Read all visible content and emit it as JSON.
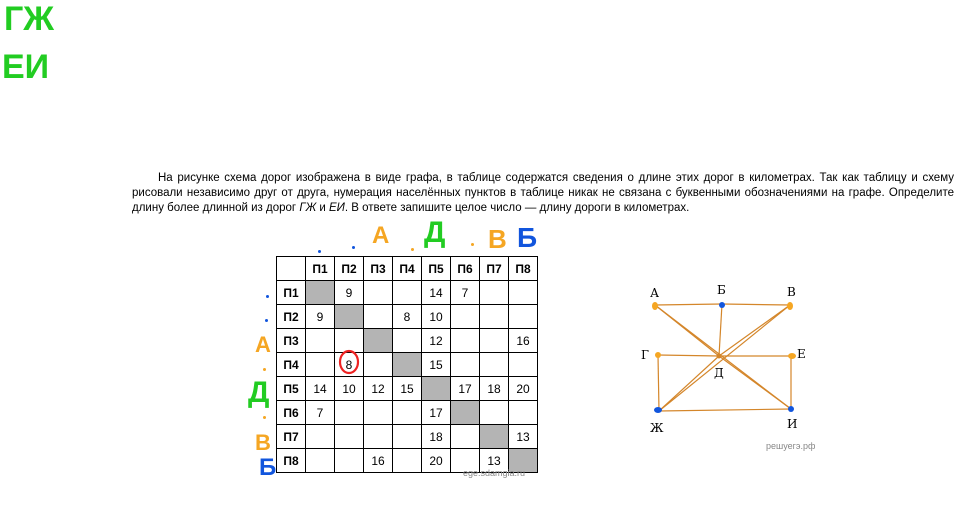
{
  "annotations": {
    "top_left_line1": "ГЖ",
    "top_left_line2": "ЕИ",
    "col_marks": [
      "А",
      "Д",
      "В",
      "Б"
    ],
    "row_marks": [
      "А",
      "Д",
      "В",
      "Б"
    ],
    "circled_value": "8"
  },
  "task": {
    "text_part1": "На рисунке схема дорог изображена в виде графа, в таблице содержатся сведения о длине этих дорог в километрах. Так как таблицу и схему рисовали независимо друг от друга, нумерация населённых пунктов в таблице никак не связана с буквенными обозначениями на графе. Определите длину более длинной из дорог ",
    "road1": "ГЖ",
    "conj": " и ",
    "road2": "ЕИ",
    "text_part2": ". В ответе запишите целое число — длину дороги в километрах."
  },
  "table": {
    "headers": [
      "П1",
      "П2",
      "П3",
      "П4",
      "П5",
      "П6",
      "П7",
      "П8"
    ],
    "rows": [
      {
        "label": "П1",
        "cells": [
          "",
          "9",
          "",
          "",
          "14",
          "7",
          "",
          ""
        ]
      },
      {
        "label": "П2",
        "cells": [
          "9",
          "",
          "",
          "8",
          "10",
          "",
          "",
          ""
        ]
      },
      {
        "label": "П3",
        "cells": [
          "",
          "",
          "",
          "",
          "12",
          "",
          "",
          "16"
        ]
      },
      {
        "label": "П4",
        "cells": [
          "",
          "8",
          "",
          "",
          "15",
          "",
          "",
          ""
        ]
      },
      {
        "label": "П5",
        "cells": [
          "14",
          "10",
          "12",
          "15",
          "",
          "17",
          "18",
          "20"
        ]
      },
      {
        "label": "П6",
        "cells": [
          "7",
          "",
          "",
          "",
          "17",
          "",
          "",
          ""
        ]
      },
      {
        "label": "П7",
        "cells": [
          "",
          "",
          "",
          "",
          "18",
          "",
          "",
          "13"
        ]
      },
      {
        "label": "П8",
        "cells": [
          "",
          "",
          "16",
          "",
          "20",
          "",
          "13",
          ""
        ]
      }
    ],
    "watermark": "ege.sdamgia.ru"
  },
  "graph": {
    "vertices": [
      "А",
      "Б",
      "В",
      "Г",
      "Д",
      "Е",
      "Ж",
      "И"
    ],
    "edges": [
      [
        "А",
        "Б"
      ],
      [
        "Б",
        "В"
      ],
      [
        "А",
        "Д"
      ],
      [
        "Б",
        "Д"
      ],
      [
        "В",
        "Д"
      ],
      [
        "Г",
        "Д"
      ],
      [
        "Д",
        "Е"
      ],
      [
        "Д",
        "Ж"
      ],
      [
        "Д",
        "И"
      ],
      [
        "Г",
        "Ж"
      ],
      [
        "Е",
        "И"
      ],
      [
        "Ж",
        "И"
      ],
      [
        "Ж",
        "В"
      ],
      [
        "А",
        "И"
      ]
    ],
    "watermark": "решуегэ.рф",
    "edge_color": "#d4862a"
  }
}
